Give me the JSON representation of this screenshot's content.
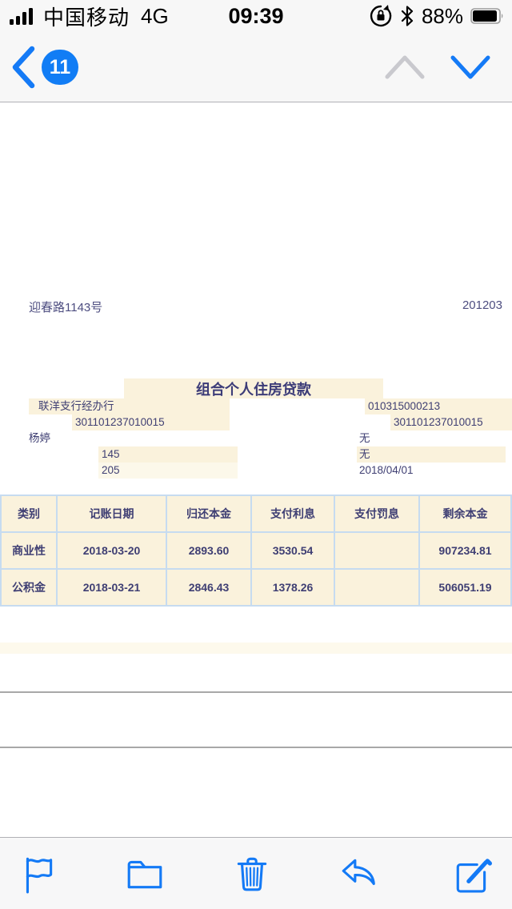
{
  "status_bar": {
    "carrier": "中国移动",
    "network": "4G",
    "time": "09:39",
    "battery_percent": "88%",
    "icons": [
      "signal-bars-icon",
      "orientation-lock-icon",
      "bluetooth-icon",
      "battery-icon"
    ]
  },
  "nav": {
    "back_badge_count": "11",
    "icons": [
      "back-chevron-icon",
      "chevron-up-icon",
      "chevron-down-icon"
    ]
  },
  "document": {
    "address": "迎春路1143号",
    "postcode": "201203",
    "title": "组合个人住房贷款",
    "fields": [
      {
        "left": "联洋支行经办行",
        "right": "010315000213"
      },
      {
        "left": "301101237010015",
        "right": "301101237010015"
      },
      {
        "left": "杨婷",
        "right": "无"
      },
      {
        "left": "145",
        "right": "无"
      },
      {
        "left": "205",
        "right": "2018/04/01"
      }
    ]
  },
  "table": {
    "headers": [
      "类别",
      "记账日期",
      "归还本金",
      "支付利息",
      "支付罚息",
      "剩余本金"
    ],
    "rows": [
      [
        "商业性",
        "2018-03-20",
        "2893.60",
        "3530.54",
        "",
        "907234.81"
      ],
      [
        "公积金",
        "2018-03-21",
        "2846.43",
        "1378.26",
        "",
        "506051.19"
      ]
    ]
  },
  "toolbar": {
    "icons": [
      "flag-icon",
      "folder-icon",
      "trash-icon",
      "reply-icon",
      "compose-icon"
    ]
  },
  "colors": {
    "accent_blue": "#147af6",
    "highlight_cream": "#faf2dc",
    "highlight_cream_light": "#fcf8ea",
    "table_border_blue": "#c6dbf0",
    "text_indigo": "#3e3e73",
    "bar_background": "#f7f7f7"
  }
}
